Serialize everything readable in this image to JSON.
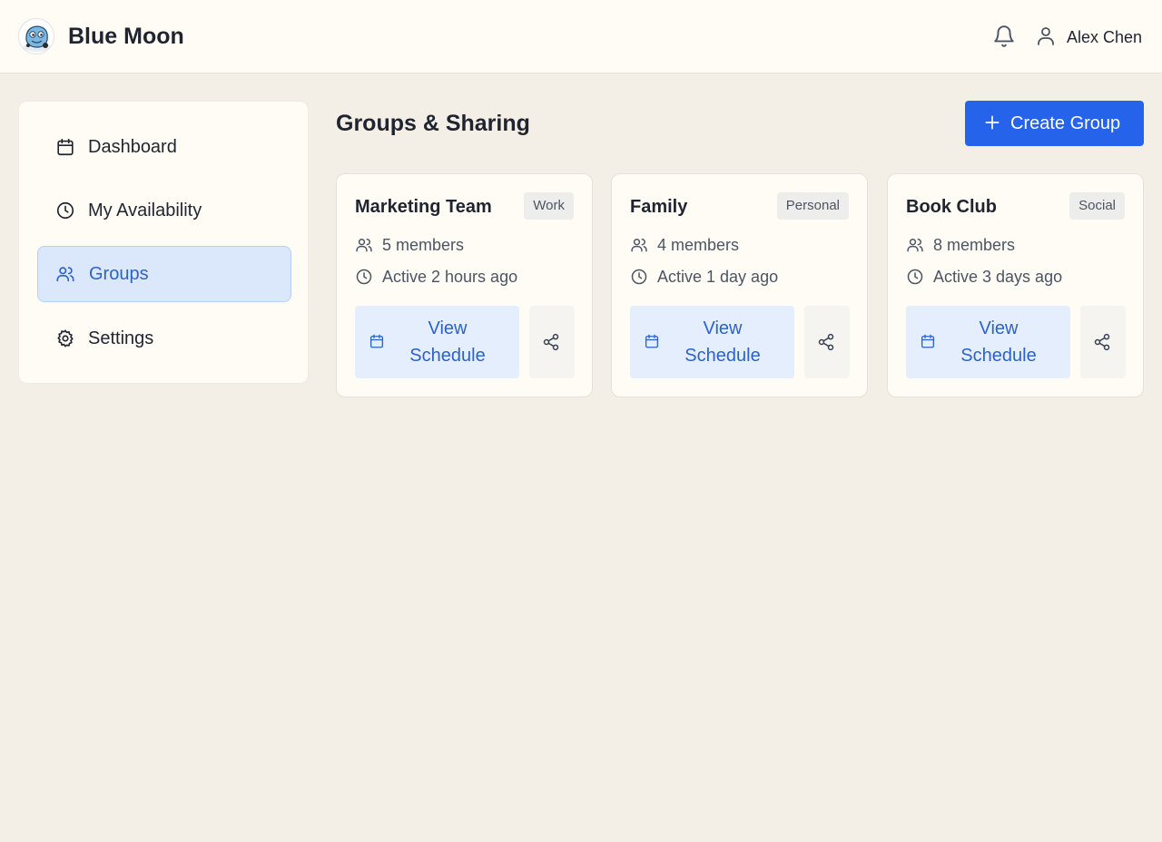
{
  "app": {
    "title": "Blue Moon"
  },
  "header": {
    "user_name": "Alex Chen"
  },
  "sidebar": {
    "items": [
      {
        "label": "Dashboard",
        "icon": "calendar-icon",
        "active": false
      },
      {
        "label": "My Availability",
        "icon": "clock-icon",
        "active": false
      },
      {
        "label": "Groups",
        "icon": "users-icon",
        "active": true
      },
      {
        "label": "Settings",
        "icon": "gear-icon",
        "active": false
      }
    ]
  },
  "main": {
    "title": "Groups & Sharing",
    "create_label": "Create Group",
    "groups": [
      {
        "name": "Marketing Team",
        "tag": "Work",
        "members": "5 members",
        "activity": "Active 2 hours ago",
        "view_label": "View Schedule"
      },
      {
        "name": "Family",
        "tag": "Personal",
        "members": "4 members",
        "activity": "Active 1 day ago",
        "view_label": "View Schedule"
      },
      {
        "name": "Book Club",
        "tag": "Social",
        "members": "8 members",
        "activity": "Active 3 days ago",
        "view_label": "View Schedule"
      }
    ]
  },
  "colors": {
    "accent": "#2563eb",
    "active_nav_bg": "#dbe8fb",
    "page_bg": "#f3efe7",
    "panel_bg": "#fffcf5"
  }
}
